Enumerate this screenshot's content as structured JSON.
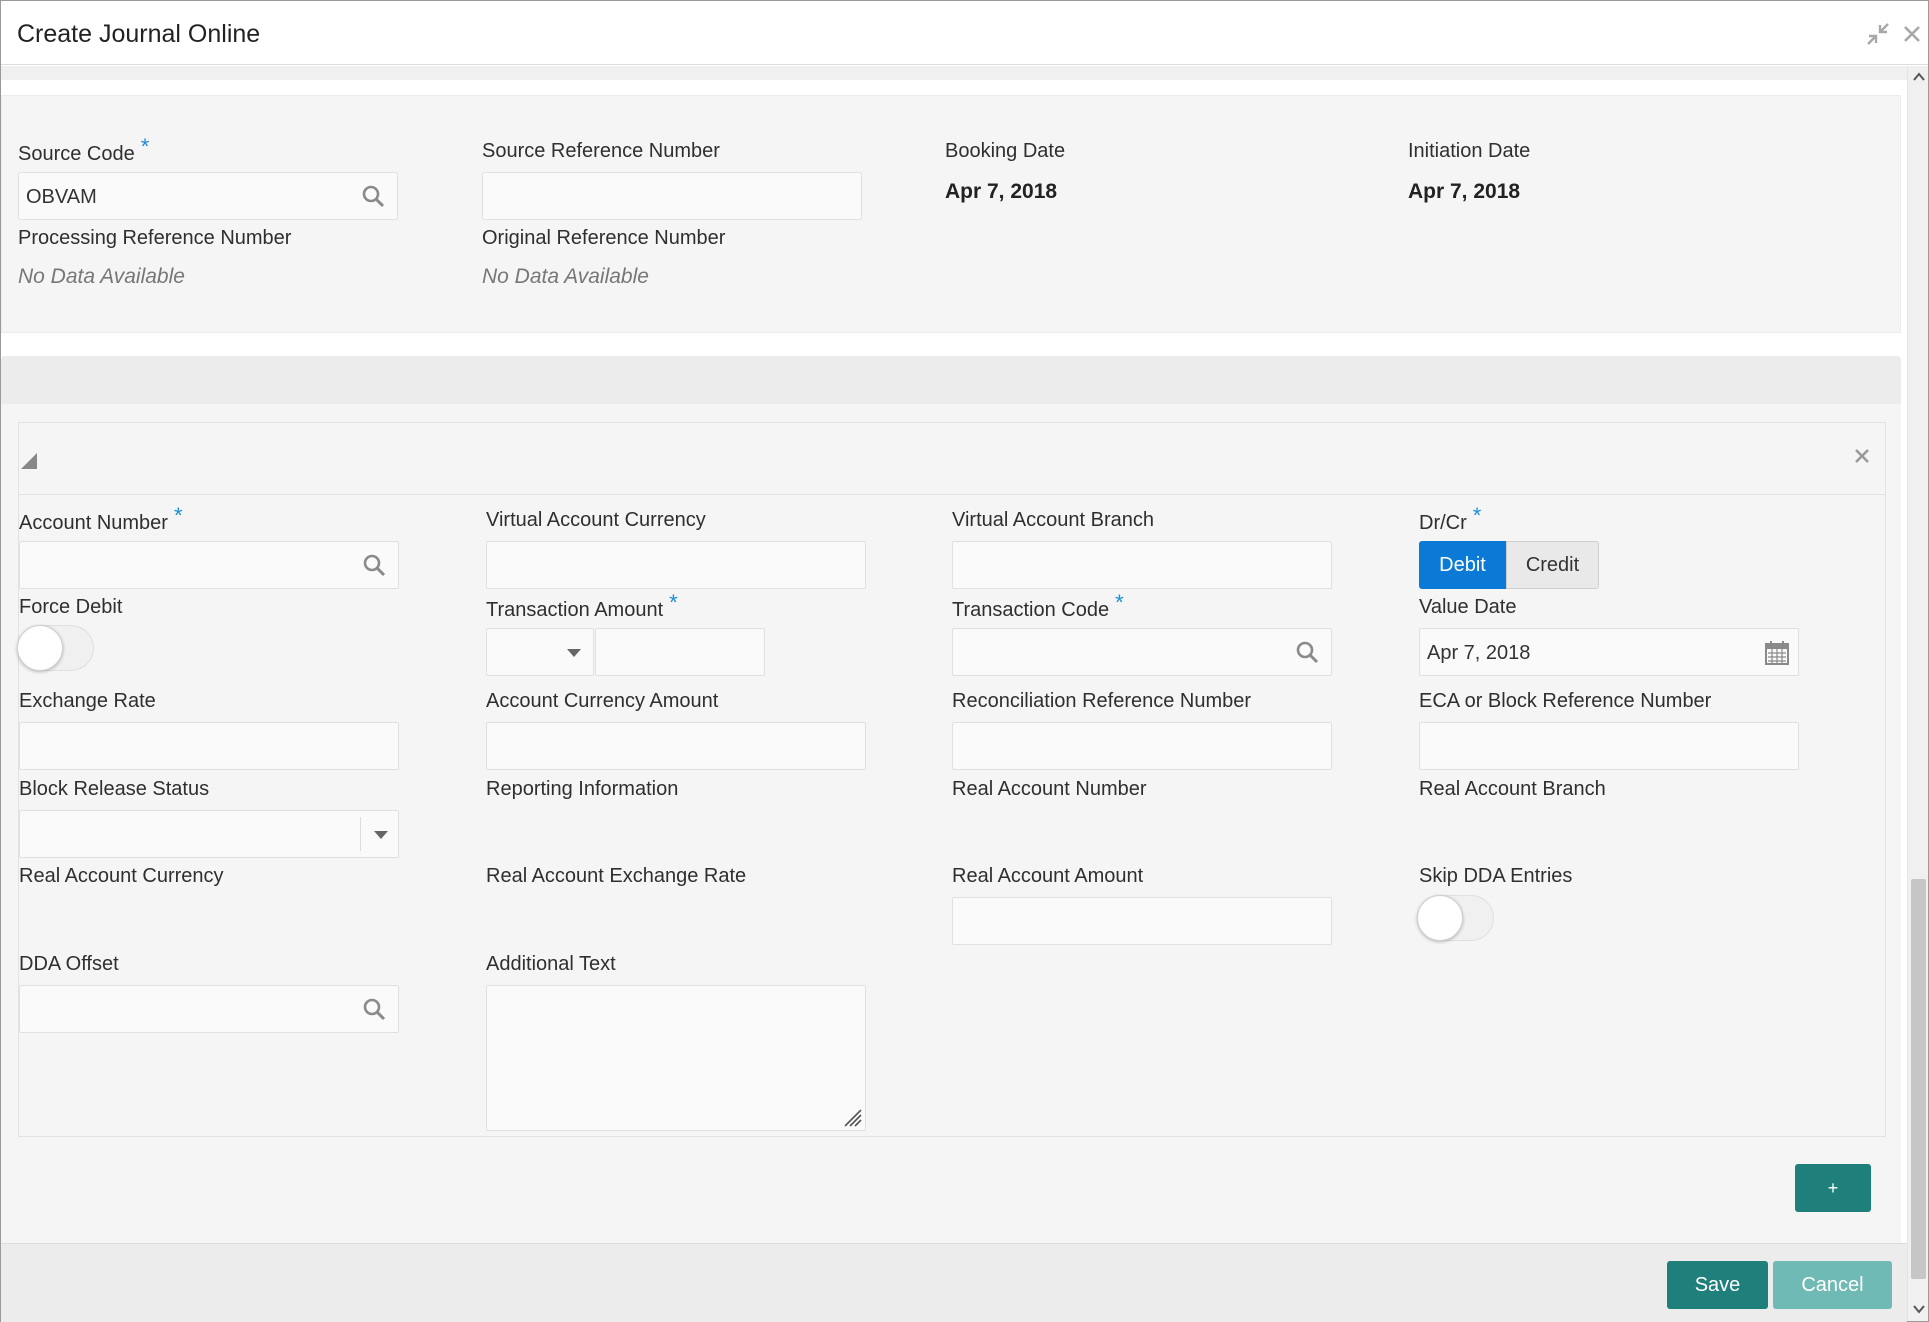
{
  "window": {
    "title": "Create Journal Online",
    "icons": {
      "minimize": "compress-icon",
      "close": "close-icon"
    }
  },
  "header": {
    "source_code": {
      "label": "Source Code",
      "required": "*",
      "value": "OBVAM",
      "icon": "search-icon"
    },
    "source_reference_number": {
      "label": "Source Reference Number",
      "value": ""
    },
    "booking_date": {
      "label": "Booking Date",
      "value": "Apr 7, 2018"
    },
    "initiation_date": {
      "label": "Initiation Date",
      "value": "Apr 7, 2018"
    },
    "processing_reference_number": {
      "label": "Processing Reference Number",
      "value": "No Data Available"
    },
    "original_reference_number": {
      "label": "Original Reference Number",
      "value": "No Data Available"
    }
  },
  "entry": {
    "account_number": {
      "label": "Account Number",
      "required": "*",
      "value": ""
    },
    "virtual_account_currency": {
      "label": "Virtual Account Currency",
      "value": ""
    },
    "virtual_account_branch": {
      "label": "Virtual Account Branch",
      "value": ""
    },
    "dr_cr": {
      "label": "Dr/Cr",
      "required": "*",
      "options": [
        "Debit",
        "Credit"
      ],
      "selected": "Debit"
    },
    "force_debit": {
      "label": "Force Debit",
      "on": false
    },
    "transaction_amount": {
      "label": "Transaction Amount",
      "required": "*",
      "currency": "",
      "value": ""
    },
    "transaction_code": {
      "label": "Transaction Code",
      "required": "*",
      "value": ""
    },
    "value_date": {
      "label": "Value Date",
      "value": "Apr 7, 2018",
      "icon": "calendar-icon"
    },
    "exchange_rate": {
      "label": "Exchange Rate",
      "value": ""
    },
    "account_currency_amount": {
      "label": "Account Currency Amount",
      "value": ""
    },
    "reconciliation_reference_number": {
      "label": "Reconciliation Reference Number",
      "value": ""
    },
    "eca_block_reference_number": {
      "label": "ECA or Block Reference Number",
      "value": ""
    },
    "block_release_status": {
      "label": "Block Release Status",
      "value": ""
    },
    "reporting_information": {
      "label": "Reporting Information"
    },
    "real_account_number": {
      "label": "Real Account Number"
    },
    "real_account_branch": {
      "label": "Real Account Branch"
    },
    "real_account_currency": {
      "label": "Real Account Currency"
    },
    "real_account_exchange_rate": {
      "label": "Real Account Exchange Rate"
    },
    "real_account_amount": {
      "label": "Real Account Amount",
      "value": ""
    },
    "skip_dda_entries": {
      "label": "Skip DDA Entries",
      "on": false
    },
    "dda_offset": {
      "label": "DDA Offset",
      "value": ""
    },
    "additional_text": {
      "label": "Additional Text",
      "value": ""
    }
  },
  "actions": {
    "add": "+",
    "save": "Save",
    "cancel": "Cancel"
  },
  "colors": {
    "primary_teal": "#1f7f7a",
    "teal_light": "#6fbab4",
    "active_blue": "#0a7ad6",
    "required_blue": "#1a8fd6"
  }
}
